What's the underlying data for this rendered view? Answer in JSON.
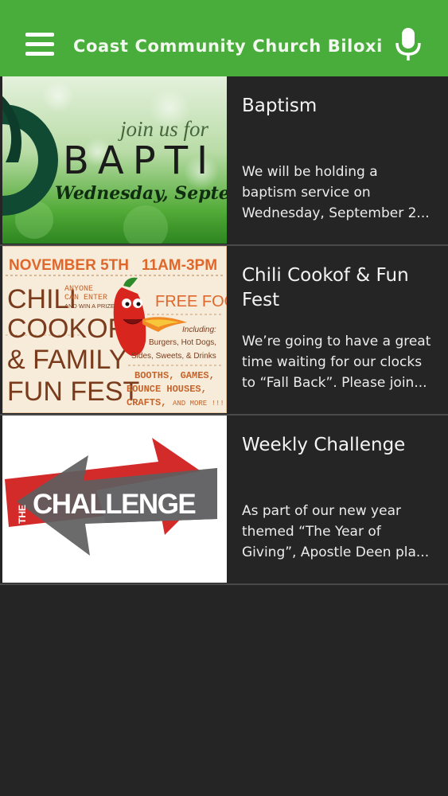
{
  "header": {
    "title": "Coast Community Church Biloxi",
    "menu_icon": "hamburger-menu-icon",
    "mic_icon": "microphone-icon"
  },
  "colors": {
    "appbar": "#49ad3c",
    "background": "#252526",
    "divider": "#4a4a4b"
  },
  "feed": [
    {
      "title": "Baptism",
      "desc_lines": [
        "We will be holding a",
        "baptism service on",
        "Wednesday, September 2..."
      ],
      "image": {
        "line1": "join us for",
        "line2": "BAPTI",
        "line3": "Wednesday, Septe"
      }
    },
    {
      "title_lines": [
        "Chili Cookof  & Fun",
        "Fest"
      ],
      "desc_lines": [
        "We’re going to have a great",
        "time waiting for our clocks",
        "to “Fall Back”. Please join..."
      ],
      "image": {
        "date": "NOVEMBER 5TH",
        "time": "11AM-3PM",
        "chili": "CHILI",
        "anyone": "ANYONE",
        "can_enter": "CAN ENTER",
        "win": "AND WIN A PRIZE!",
        "cookoff": "COOKOFF",
        "family": "& FAMILY",
        "fun_fest": "FUN FEST",
        "free_food": "FREE FOOD",
        "including": "Including:",
        "items1": "Burgers, Hot Dogs,",
        "items2": "Sides, Sweets, & Drinks",
        "booths": "BOOTHS, GAMES,",
        "bounce": "BOUNCE HOUSES,",
        "crafts": "CRAFTS,",
        "more": "AND MORE !!!"
      }
    },
    {
      "title": "Weekly Challenge",
      "desc_lines": [
        "As part of our new year",
        "themed “The Year of",
        "Giving”, Apostle Deen pla..."
      ],
      "image": {
        "the": "THE",
        "challenge": "CHALLENGE"
      }
    }
  ]
}
